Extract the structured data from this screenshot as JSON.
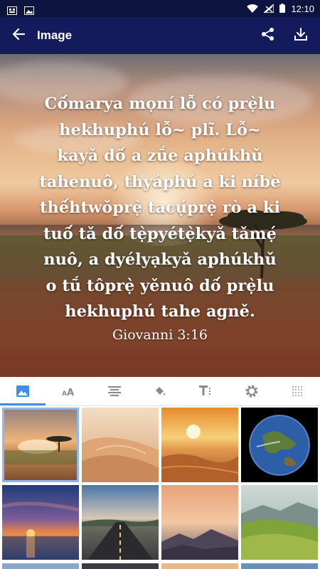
{
  "status_bar": {
    "time": "12:10",
    "left_icons": [
      "gallery-icon",
      "image-icon"
    ],
    "right_icons": [
      "wifi-icon",
      "signal-icon",
      "battery-icon"
    ]
  },
  "app_bar": {
    "title": "Image",
    "back_icon": "arrow-back-icon",
    "actions": [
      "share-icon",
      "download-icon"
    ],
    "background": "#131b5c"
  },
  "preview": {
    "verse_lines": [
      "Cố́marya mọní lỗ có prẹ̀lu",
      "hekhuphú lỗ~ plĩ. Lỗ~",
      "kayǎ dố́ a zṹe aphúkhǔ",
      "tahenuô, thyáphú a ki níbè",
      "thế́htwǒprẹ̀ tacụ́prẹ̀ rò a ki",
      "tuố́ tǎ dố́ tẹ̀pyétẹ̀kyǎ tǎmẹ́",
      "nuô, a dyélyạkyǎ aphúkhǔ",
      "o tṹ tôprẹ̀ yěnuô dố́ prẹ̀lu",
      "hekhuphú tahe agně."
    ],
    "reference": "Giovanni 3:16"
  },
  "tabs": [
    {
      "icon": "image-icon",
      "active": true
    },
    {
      "icon": "font-size-icon",
      "active": false
    },
    {
      "icon": "align-center-icon",
      "active": false
    },
    {
      "icon": "paint-bucket-icon",
      "active": false
    },
    {
      "icon": "text-format-icon",
      "active": false
    },
    {
      "icon": "settings-gear-icon",
      "active": false
    },
    {
      "icon": "texture-icon",
      "active": false
    }
  ],
  "gallery": {
    "thumbnails": [
      {
        "subject": "sunset-acacia-tree",
        "selected": true
      },
      {
        "subject": "sand-dunes",
        "selected": false
      },
      {
        "subject": "desert-sunset",
        "selected": false
      },
      {
        "subject": "earth-from-space",
        "selected": false
      },
      {
        "subject": "sunset-over-sea",
        "selected": false
      },
      {
        "subject": "road-at-dusk",
        "selected": false
      },
      {
        "subject": "mountain-sunset",
        "selected": false
      },
      {
        "subject": "green-hills",
        "selected": false
      }
    ]
  },
  "colors": {
    "status_bar": "#0d1440",
    "accent": "#3d8ee8",
    "tab_icon": "#8a8a8a"
  }
}
